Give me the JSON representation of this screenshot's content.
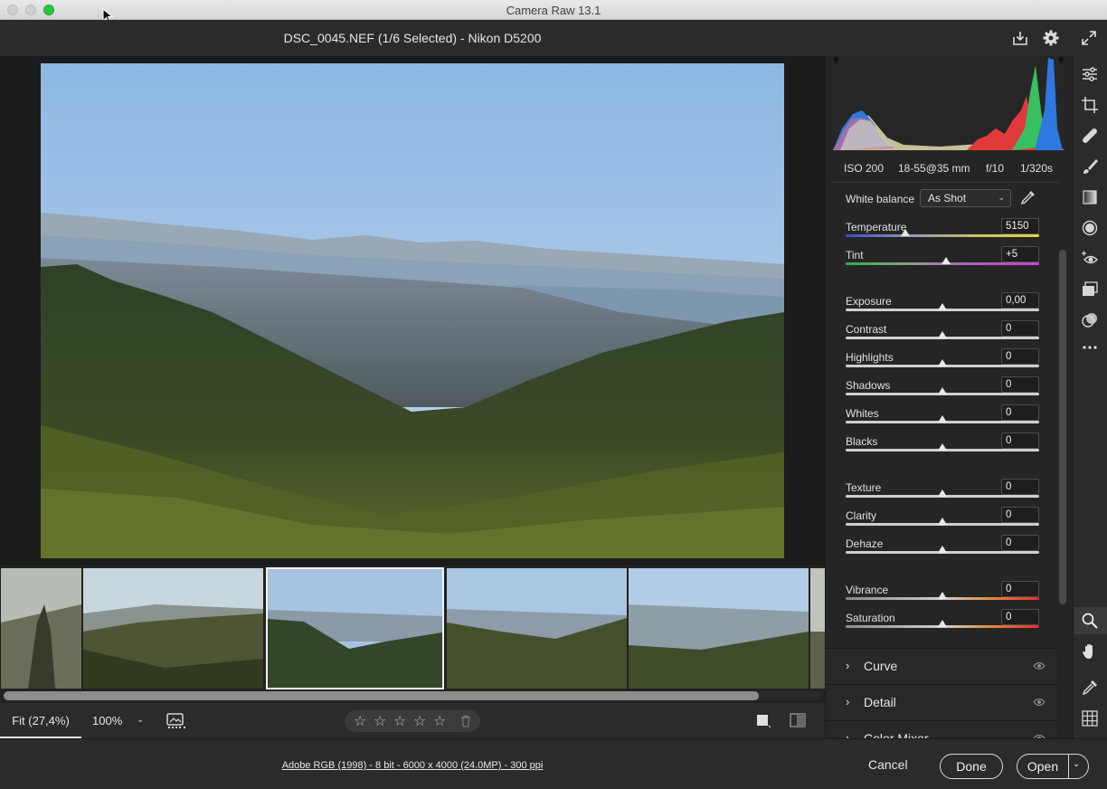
{
  "window": {
    "title": "Camera Raw 13.1"
  },
  "header": {
    "file_title": "DSC_0045.NEF (1/6 Selected)  -  Nikon D5200"
  },
  "camera_info": {
    "iso": "ISO 200",
    "lens": "18-55@35 mm",
    "aperture": "f/10",
    "shutter": "1/320s"
  },
  "white_balance": {
    "label": "White balance",
    "value": "As Shot"
  },
  "sliders": [
    {
      "label": "Temperature",
      "value": "5150",
      "level": 0.31
    },
    {
      "label": "Tint",
      "value": "+5",
      "level": 0.52
    },
    {
      "label": "Exposure",
      "value": "0,00",
      "level": 0.5
    },
    {
      "label": "Contrast",
      "value": "0",
      "level": 0.5
    },
    {
      "label": "Highlights",
      "value": "0",
      "level": 0.5
    },
    {
      "label": "Shadows",
      "value": "0",
      "level": 0.5
    },
    {
      "label": "Whites",
      "value": "0",
      "level": 0.5
    },
    {
      "label": "Blacks",
      "value": "0",
      "level": 0.5
    },
    {
      "label": "Texture",
      "value": "0",
      "level": 0.5
    },
    {
      "label": "Clarity",
      "value": "0",
      "level": 0.5
    },
    {
      "label": "Dehaze",
      "value": "0",
      "level": 0.5
    },
    {
      "label": "Vibrance",
      "value": "0",
      "level": 0.5
    },
    {
      "label": "Saturation",
      "value": "0",
      "level": 0.5
    }
  ],
  "sections": [
    {
      "title": "Curve"
    },
    {
      "title": "Detail"
    },
    {
      "title": "Color Mixer"
    }
  ],
  "viewbar": {
    "zoom_fit": "Fit (27,4%)",
    "zoom_100": "100%"
  },
  "footer": {
    "workflow": "Adobe RGB (1998) - 8 bit - 6000 x 4000 (24.0MP) - 300 ppi",
    "cancel": "Cancel",
    "done": "Done",
    "open": "Open"
  },
  "filmstrip": {
    "count": 6,
    "selected_index": 2
  },
  "colors": {
    "accent_green": "#2ac940",
    "panel_bg": "#252525",
    "toolbar_bg": "#2b2b2b"
  }
}
